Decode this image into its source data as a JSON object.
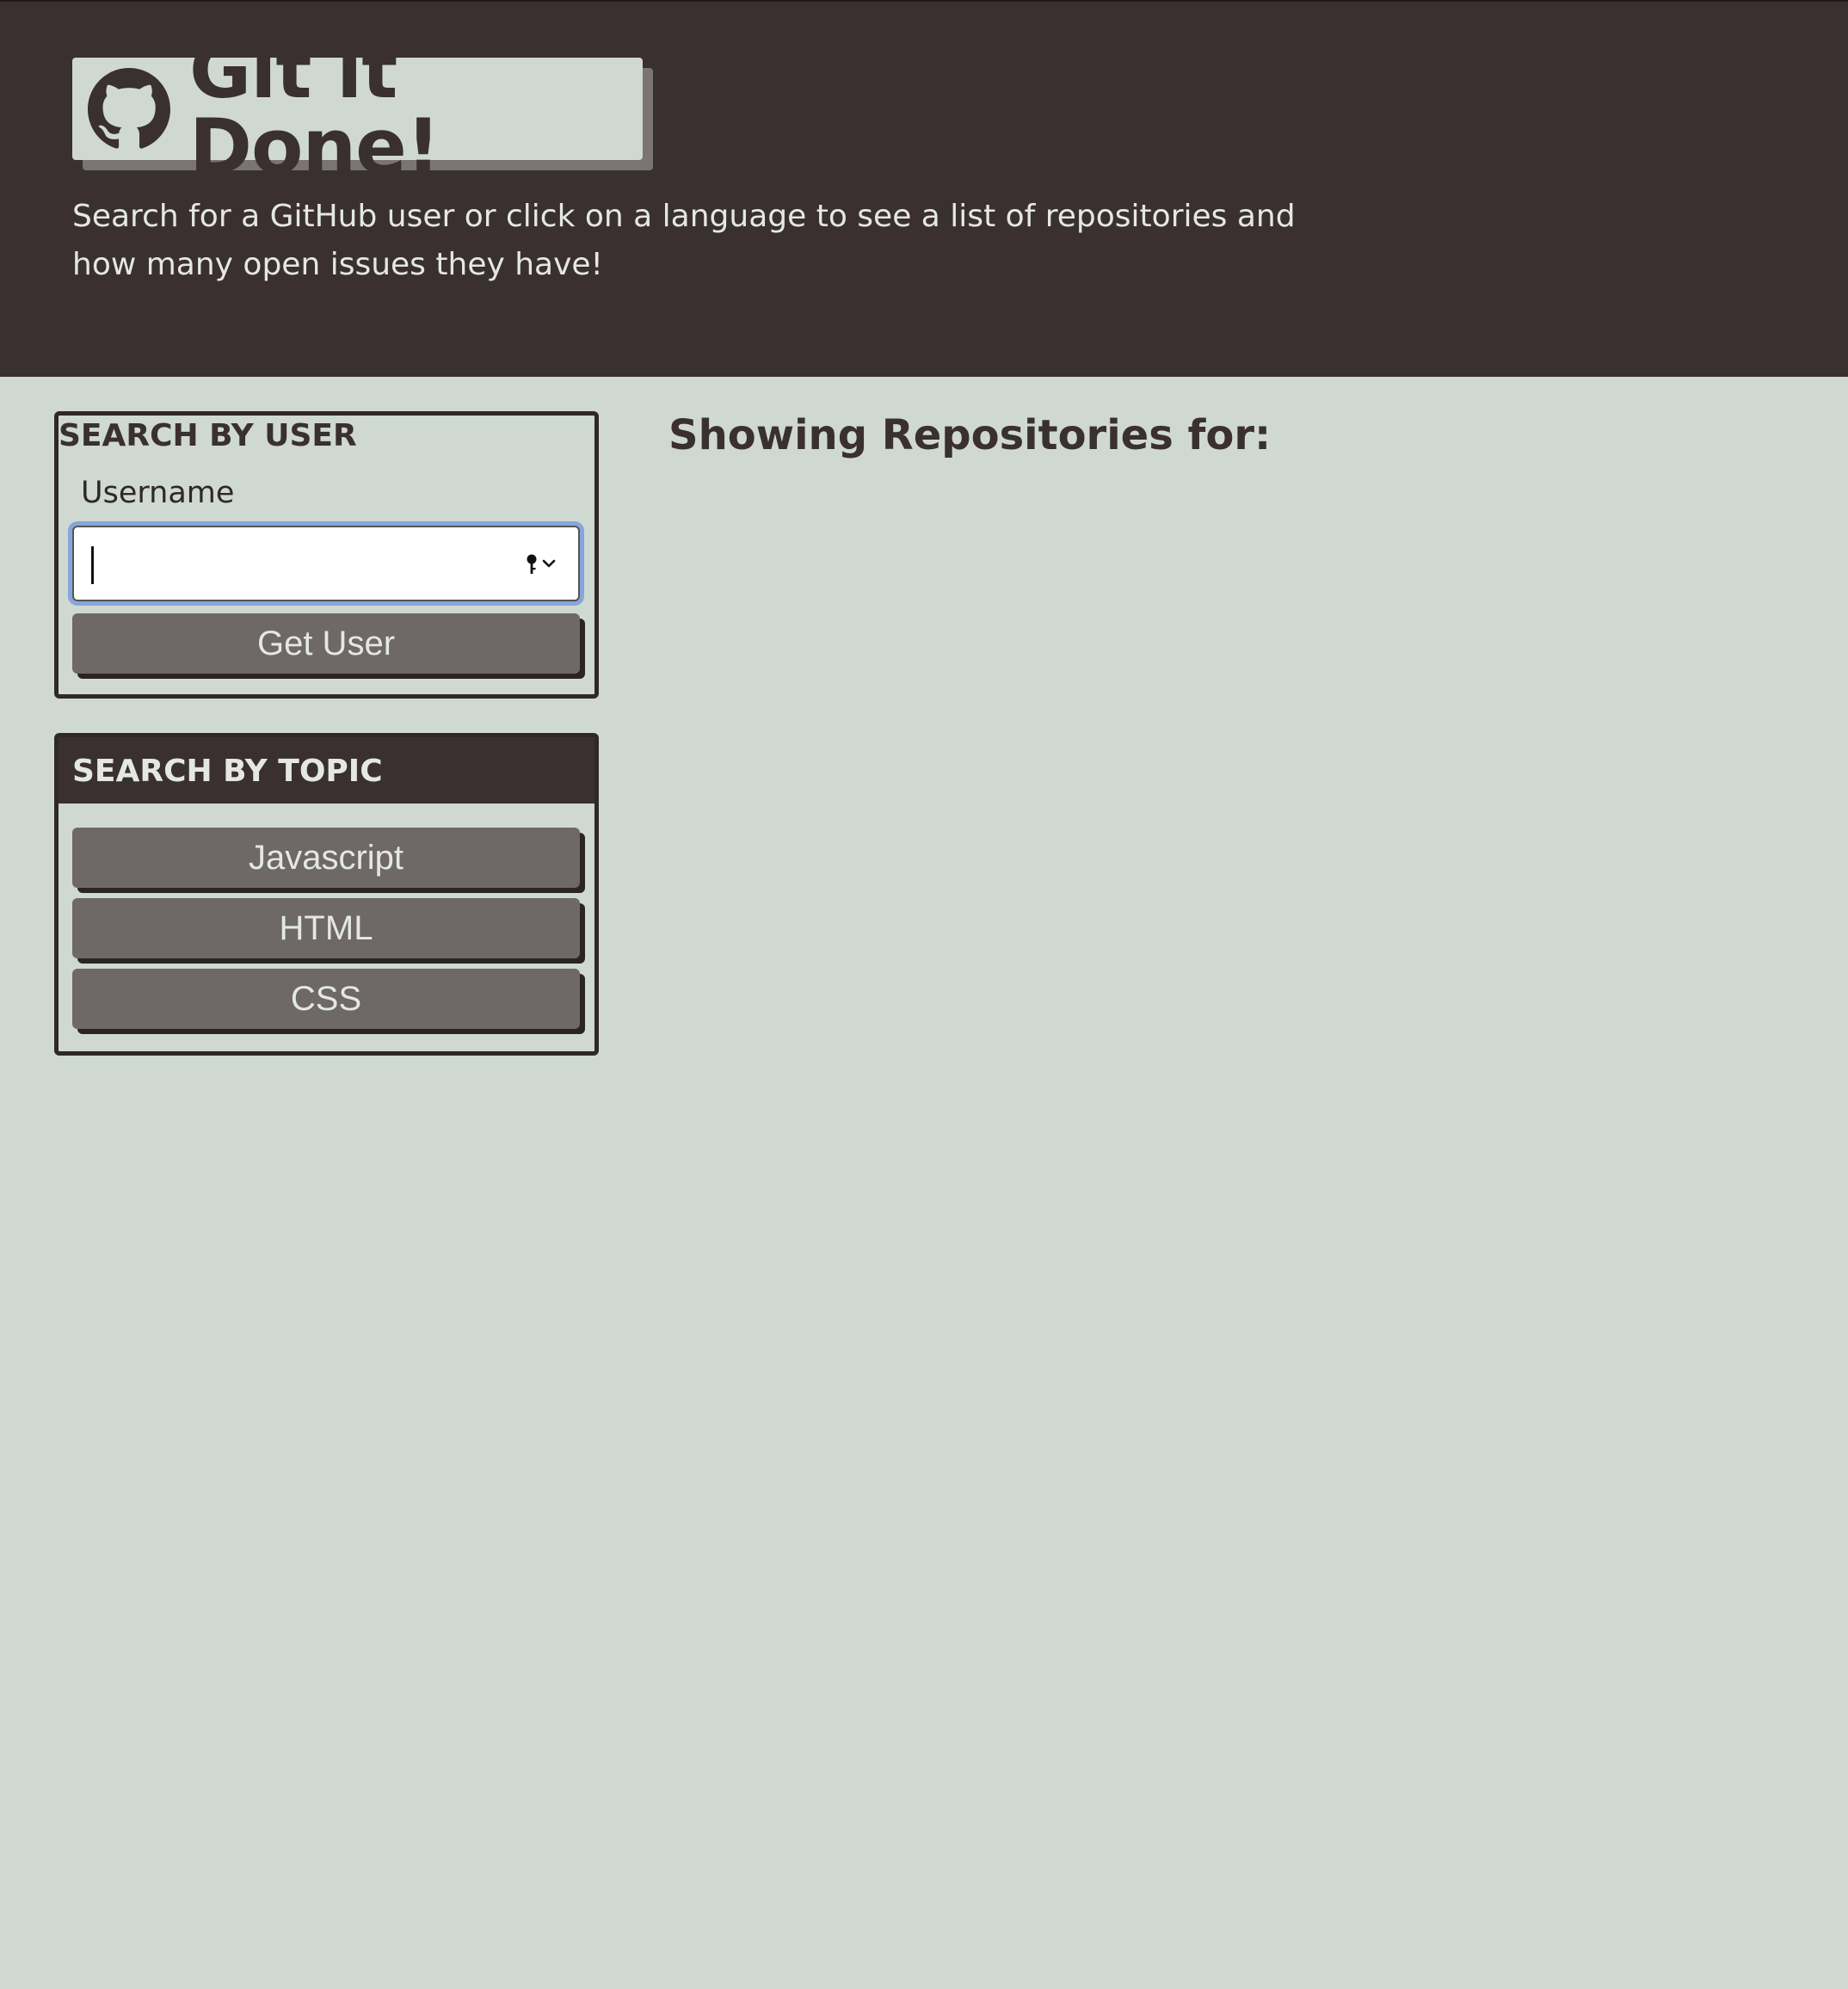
{
  "header": {
    "title": "Git it Done!",
    "tagline": "Search for a GitHub user or click on a language to see a list of repositories and how many open issues they have!",
    "logo_icon": "github-icon"
  },
  "user_search": {
    "title": "SEARCH BY USER",
    "label": "Username",
    "input_value": "",
    "button_label": "Get User"
  },
  "topic_search": {
    "title": "SEARCH BY TOPIC",
    "buttons": [
      "Javascript",
      "HTML",
      "CSS"
    ]
  },
  "repos": {
    "heading": "Showing Repositories for:"
  },
  "colors": {
    "header_bg": "#3a3030",
    "page_bg": "#cfd9d1",
    "button_bg": "#6e6867",
    "focus_ring": "#86a5db"
  }
}
